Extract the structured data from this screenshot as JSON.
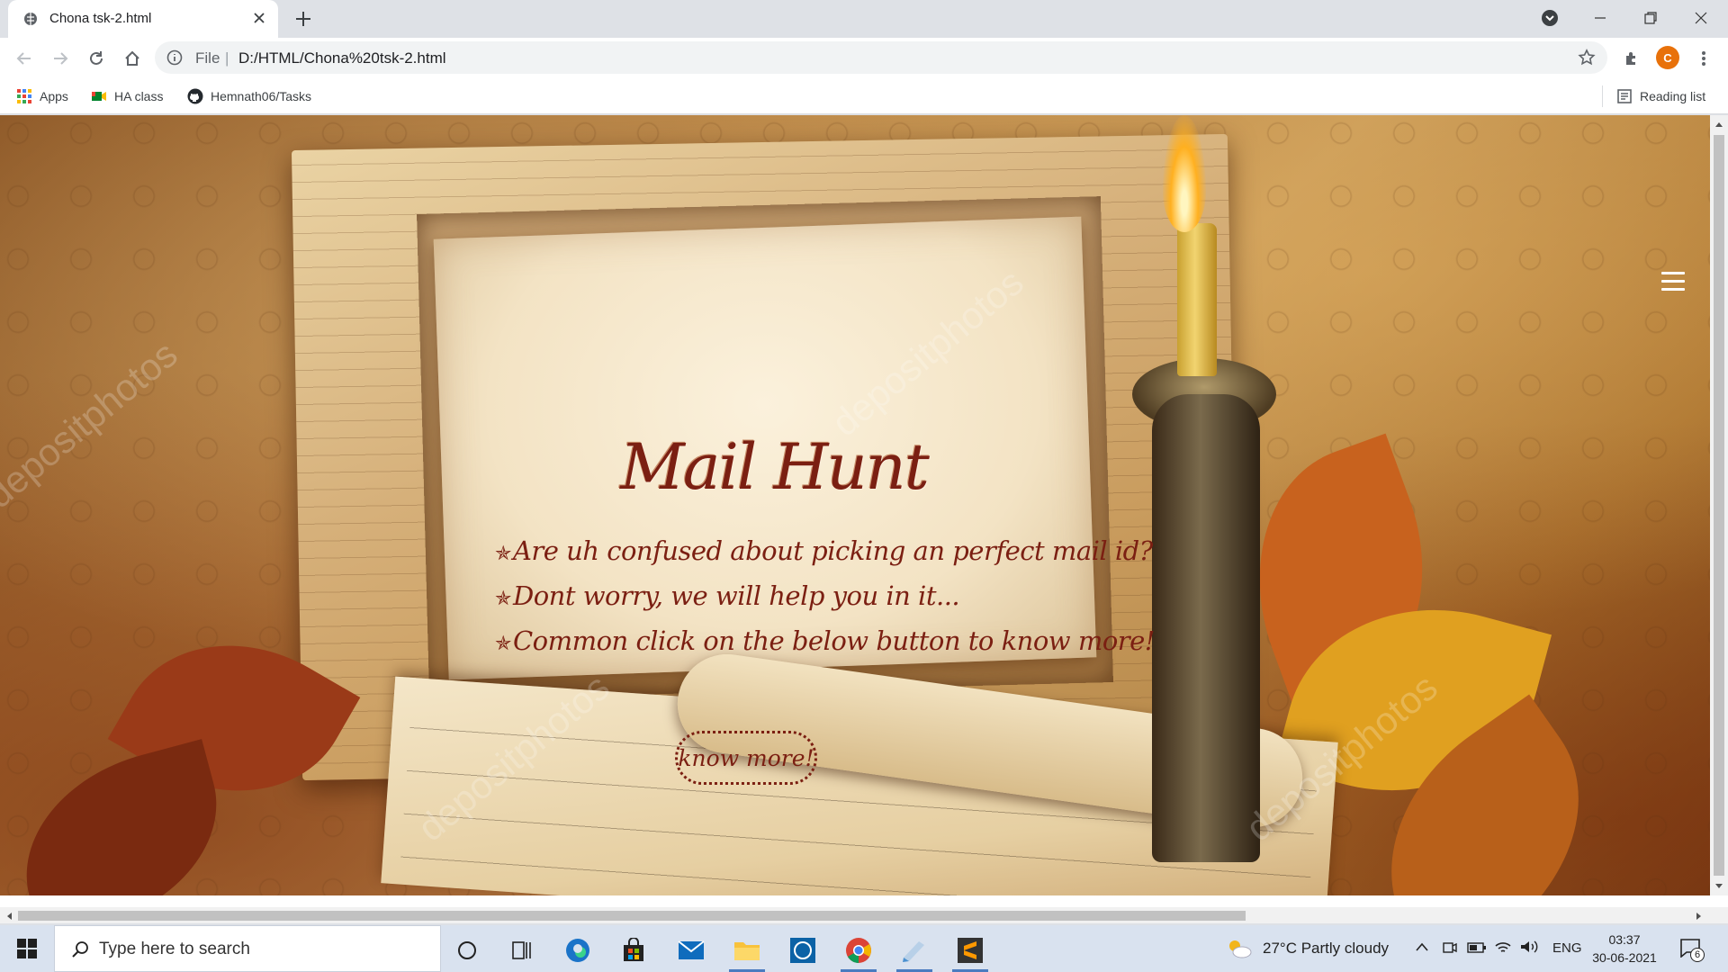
{
  "browser": {
    "tab_title": "Chona tsk-2.html",
    "omnibox": {
      "scheme": "File",
      "separator": "|",
      "url": "D:/HTML/Chona%20tsk-2.html"
    },
    "avatar_letter": "C",
    "bookmarks": [
      {
        "label": "Apps",
        "icon": "apps-grid-icon"
      },
      {
        "label": "HA class",
        "icon": "meet-icon"
      },
      {
        "label": "Hemnath06/Tasks",
        "icon": "github-icon"
      }
    ],
    "reading_list": "Reading list"
  },
  "page": {
    "brand": "Mail Hunt",
    "lines": [
      "Are uh confused about picking an perfect mail id?",
      "Dont worry, we will help you in it...",
      "Common click on the below button to know more!"
    ],
    "bullet": "✯",
    "cta_label": "know more!",
    "watermark": "depositphotos",
    "text_color": "#7b1f12"
  },
  "taskbar": {
    "search_placeholder": "Type here to search",
    "weather": "27°C  Partly cloudy",
    "language": "ENG",
    "time": "03:37",
    "date": "30-06-2021",
    "notification_count": "6"
  }
}
